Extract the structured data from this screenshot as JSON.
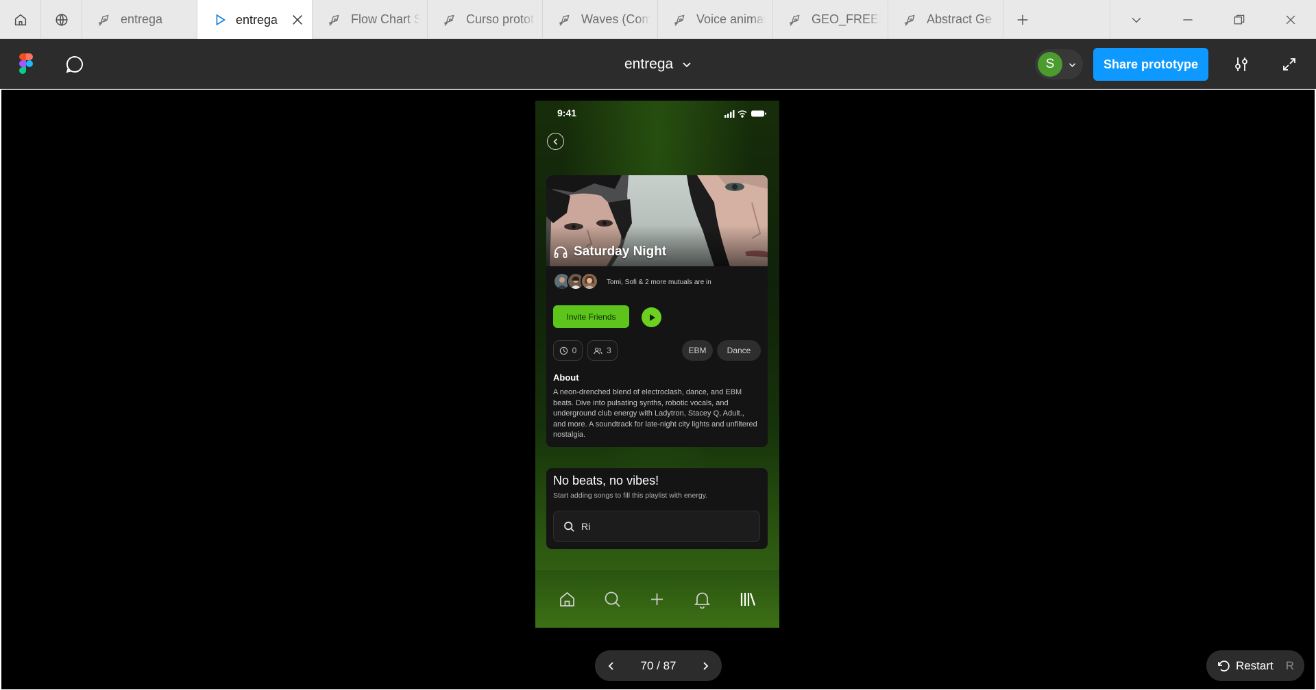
{
  "browser": {
    "tabs": [
      {
        "label": "entrega",
        "icon": "pen-tool-icon"
      },
      {
        "label": "entrega",
        "icon": "play-icon",
        "active": true
      },
      {
        "label": "Flow Chart S",
        "icon": "pen-tool-icon"
      },
      {
        "label": "Curso protot",
        "icon": "pen-tool-icon"
      },
      {
        "label": "Waves (Com",
        "icon": "pen-tool-icon"
      },
      {
        "label": "Voice animat",
        "icon": "pen-tool-icon"
      },
      {
        "label": "GEO_FREEBI",
        "icon": "pen-tool-icon"
      },
      {
        "label": "Abstract Ge",
        "icon": "pen-tool-icon"
      }
    ]
  },
  "header": {
    "file_name": "entrega",
    "avatar_initial": "S",
    "share_label": "Share prototype"
  },
  "phone": {
    "time": "9:41",
    "playlist": {
      "title": "Saturday Night",
      "mutuals_text": "Tomi, Sofi & 2 more mutuals are in",
      "invite_label": "Invite Friends",
      "duration_count": "0",
      "member_count": "3",
      "tags": [
        "EBM",
        "Dance"
      ],
      "about_heading": "About",
      "about_text": "A neon-drenched blend of electroclash, dance, and EBM beats. Dive into pulsating synths, robotic vocals, and underground club energy with Ladytron, Stacey Q, Adult., and more. A soundtrack for late-night city lights and unfiltered nostalgia."
    },
    "empty_state": {
      "heading": "No beats, no vibes!",
      "subtext": "Start adding songs to fill this playlist with energy.",
      "search_value": "Ri"
    }
  },
  "prototype": {
    "page_indicator": "70 / 87",
    "restart_label": "Restart",
    "restart_key": "R"
  },
  "colors": {
    "accent_green": "#5cc41a",
    "figma_blue": "#0d99ff",
    "header_bg": "#2c2c2c"
  }
}
